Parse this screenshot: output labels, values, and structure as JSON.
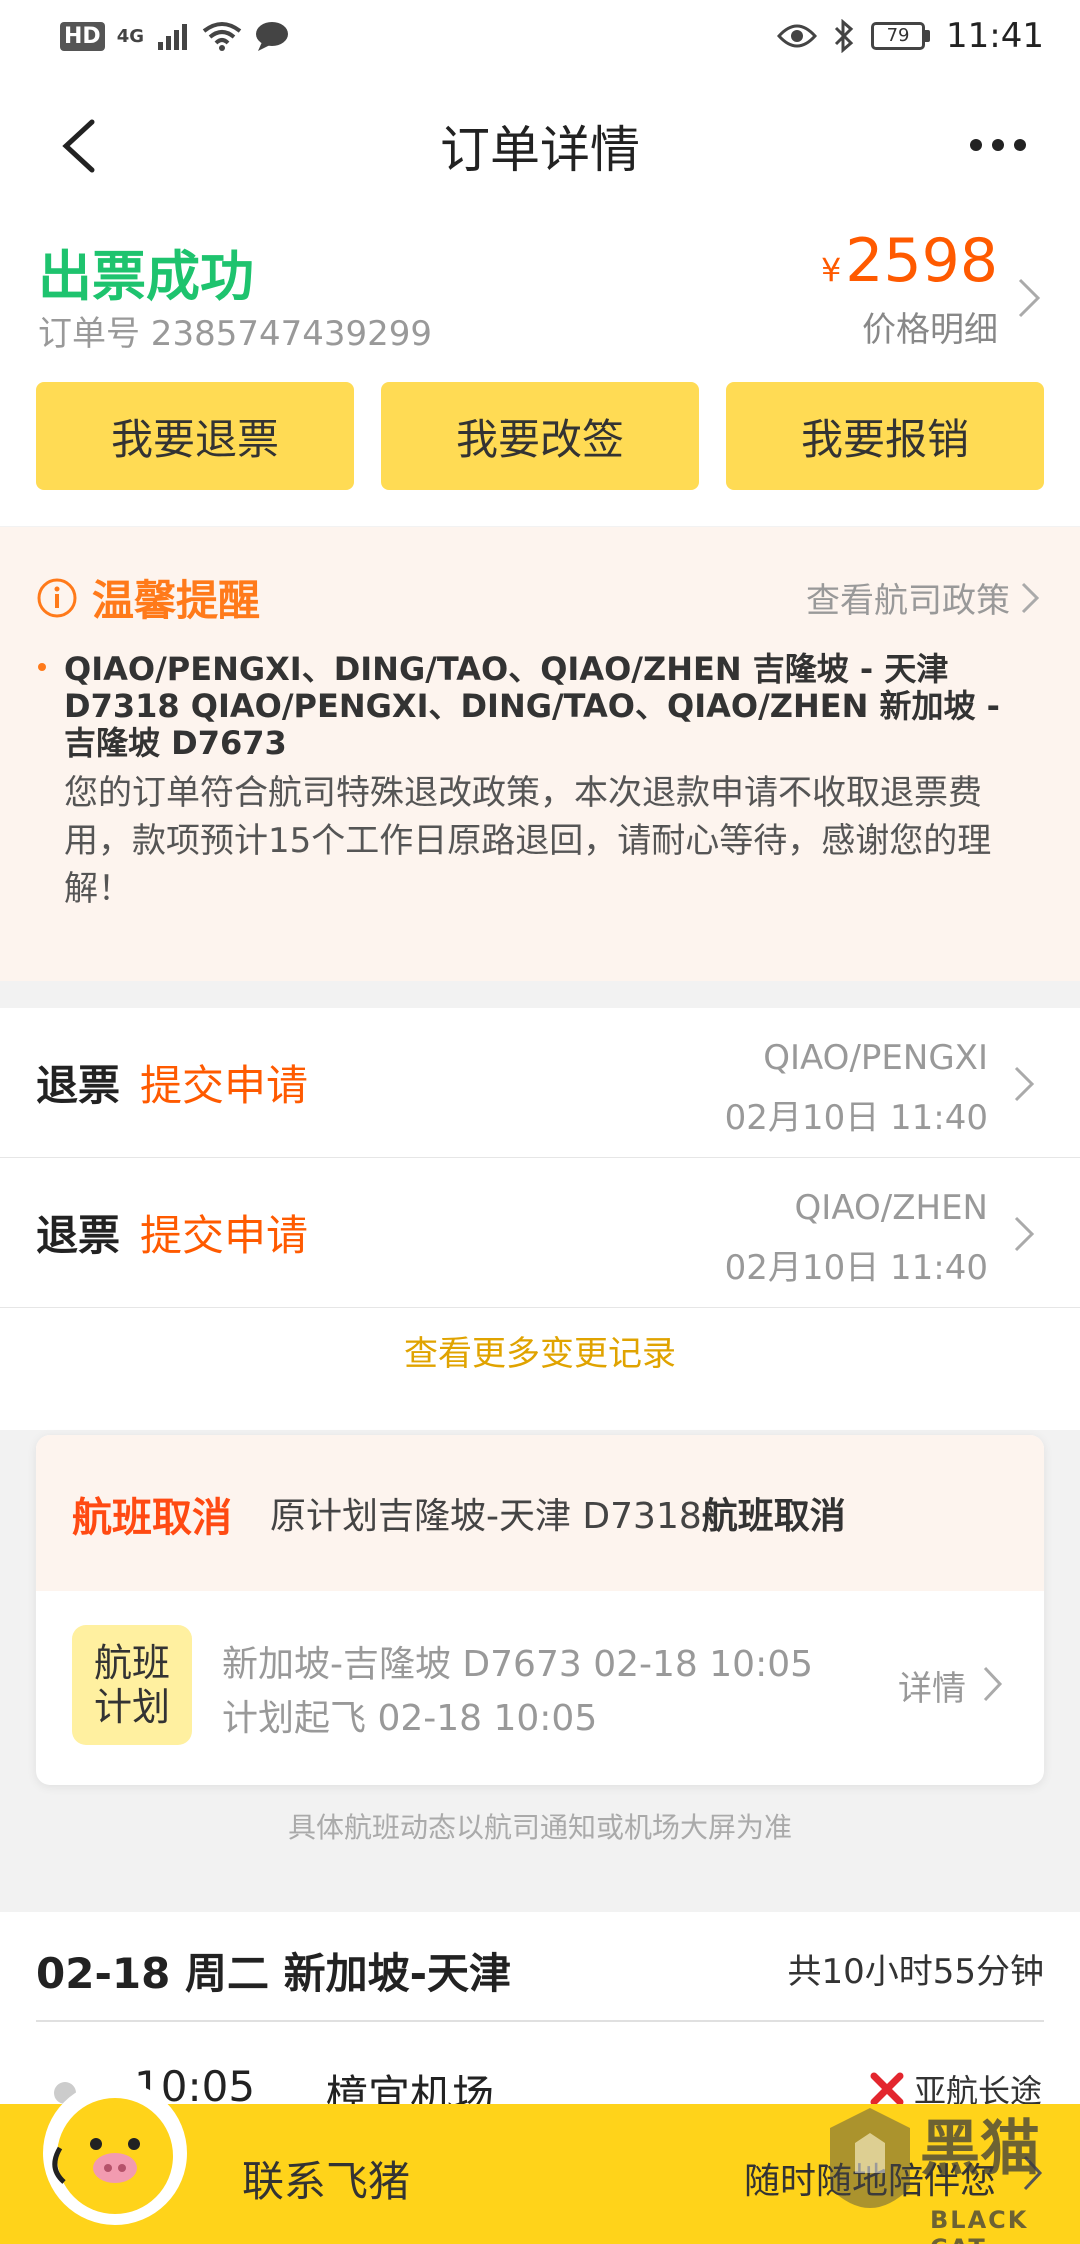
{
  "status_bar": {
    "hd": "HD",
    "network": "4G",
    "battery": "79",
    "time": "11:41"
  },
  "nav": {
    "title": "订单详情"
  },
  "order": {
    "status": "出票成功",
    "order_number": "订单号 2385747439299",
    "currency_symbol": "¥",
    "price": "2598",
    "price_detail": "价格明细",
    "status_color": "#1ec36e",
    "price_color": "#ff5a00"
  },
  "actions": [
    {
      "label": "我要退票"
    },
    {
      "label": "我要改签"
    },
    {
      "label": "我要报销"
    }
  ],
  "reminder": {
    "title": "温馨提醒",
    "policy_link": "查看航司政策",
    "routes": "QIAO/PENGXI、DING/TAO、QIAO/ZHEN 吉隆坡 - 天津 D7318 QIAO/PENGXI、DING/TAO、QIAO/ZHEN 新加坡 - 吉隆坡 D7673",
    "body": "您的订单符合航司特殊退改政策，本次退款申请不收取退票费用，款项预计15个工作日原路退回，请耐心等待，感谢您的理解！"
  },
  "changes": [
    {
      "type": "退票",
      "status": "提交申请",
      "name": "QIAO/PENGXI",
      "time": "02月10日 11:40"
    },
    {
      "type": "退票",
      "status": "提交申请",
      "name": "QIAO/ZHEN",
      "time": "02月10日 11:40"
    }
  ],
  "more_records": "查看更多变更记录",
  "cancel": {
    "tag": "航班取消",
    "desc_prefix": "原计划吉隆坡-天津 D7318",
    "desc_bold": "航班取消",
    "badge_line1": "航班",
    "badge_line2": "计划",
    "flight_line": "新加坡-吉隆坡 D7673 02-18 10:05",
    "departure_line": "计划起飞 02-18 10:05",
    "detail": "详情"
  },
  "note": "具体航班动态以航司通知或机场大屏为准",
  "itinerary": {
    "date_route": "02-18 周二 新加坡-天津",
    "duration": "共10小时55分钟",
    "time": "10:05",
    "airport": "樟宜机场",
    "airline": "亚航长途"
  },
  "bottom": {
    "contact": "联系飞猪",
    "tagline": "随时随地陪伴您"
  },
  "watermark": {
    "text": "黑猫",
    "sub": "BLACK CAT"
  }
}
